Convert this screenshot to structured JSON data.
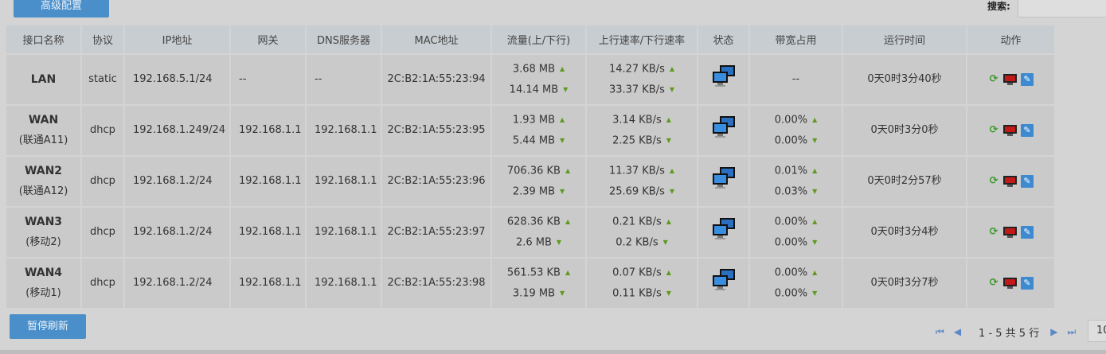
{
  "toolbar": {
    "advanced_label": "高级配置",
    "search_label": "搜索:",
    "search_value": ""
  },
  "table": {
    "headers": [
      "接口名称",
      "协议",
      "IP地址",
      "网关",
      "DNS服务器",
      "MAC地址",
      "流量(上/下行)",
      "上行速率/下行速率",
      "状态",
      "带宽占用",
      "运行时间",
      "动作"
    ],
    "rows": [
      {
        "name": "LAN",
        "sub": "",
        "protocol": "static",
        "ip": "192.168.5.1/24",
        "gateway": "--",
        "dns": "--",
        "mac": "2C:B2:1A:55:23:94",
        "traffic_up": "3.68 MB",
        "traffic_down": "14.14 MB",
        "rate_up": "14.27 KB/s",
        "rate_down": "33.37 KB/s",
        "bw_up": "",
        "bw_down": "",
        "bw_single": "--",
        "uptime": "0天0时3分40秒"
      },
      {
        "name": "WAN",
        "sub": "(联通A11)",
        "protocol": "dhcp",
        "ip": "192.168.1.249/24",
        "gateway": "192.168.1.1",
        "dns": "192.168.1.1",
        "mac": "2C:B2:1A:55:23:95",
        "traffic_up": "1.93 MB",
        "traffic_down": "5.44 MB",
        "rate_up": "3.14 KB/s",
        "rate_down": "2.25 KB/s",
        "bw_up": "0.00%",
        "bw_down": "0.00%",
        "bw_single": "",
        "uptime": "0天0时3分0秒"
      },
      {
        "name": "WAN2",
        "sub": "(联通A12)",
        "protocol": "dhcp",
        "ip": "192.168.1.2/24",
        "gateway": "192.168.1.1",
        "dns": "192.168.1.1",
        "mac": "2C:B2:1A:55:23:96",
        "traffic_up": "706.36 KB",
        "traffic_down": "2.39 MB",
        "rate_up": "11.37 KB/s",
        "rate_down": "25.69 KB/s",
        "bw_up": "0.01%",
        "bw_down": "0.03%",
        "bw_single": "",
        "uptime": "0天0时2分57秒"
      },
      {
        "name": "WAN3",
        "sub": "(移动2)",
        "protocol": "dhcp",
        "ip": "192.168.1.2/24",
        "gateway": "192.168.1.1",
        "dns": "192.168.1.1",
        "mac": "2C:B2:1A:55:23:97",
        "traffic_up": "628.36 KB",
        "traffic_down": "2.6 MB",
        "rate_up": "0.21 KB/s",
        "rate_down": "0.2 KB/s",
        "bw_up": "0.00%",
        "bw_down": "0.00%",
        "bw_single": "",
        "uptime": "0天0时3分4秒"
      },
      {
        "name": "WAN4",
        "sub": "(移动1)",
        "protocol": "dhcp",
        "ip": "192.168.1.2/24",
        "gateway": "192.168.1.1",
        "dns": "192.168.1.1",
        "mac": "2C:B2:1A:55:23:98",
        "traffic_up": "561.53 KB",
        "traffic_down": "3.19 MB",
        "rate_up": "0.07 KB/s",
        "rate_down": "0.11 KB/s",
        "bw_up": "0.00%",
        "bw_down": "0.00%",
        "bw_single": "",
        "uptime": "0天0时3分7秒"
      }
    ]
  },
  "icons": {
    "up": "arrow-up-icon",
    "down": "arrow-down-icon",
    "status": "network-monitor-icon",
    "refresh": "refresh-icon",
    "stop": "stop-icon",
    "edit": "edit-icon",
    "first": "first-page-icon",
    "prev": "prev-page-icon",
    "next": "next-page-icon",
    "last": "last-page-icon"
  },
  "footer": {
    "pause_label": "暂停刷新",
    "pager_info": "1 - 5 共 5 行",
    "page_size": "10"
  },
  "colors": {
    "button": "#4a8fc9",
    "header_bg": "#c8cdd1",
    "row_bg": "#cacaca",
    "arrow": "#5f9a1e",
    "edit_icon": "#3d8ad0"
  }
}
